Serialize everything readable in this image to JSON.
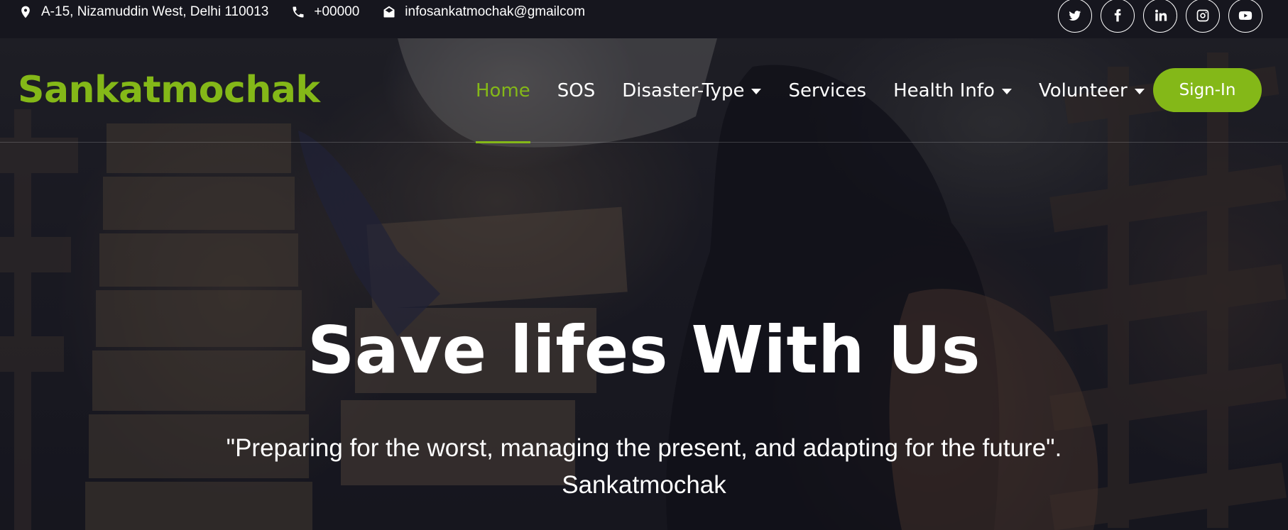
{
  "topbar": {
    "address": "A-15, Nizamuddin West, Delhi 110013",
    "phone": "+00000",
    "email": "infosankatmochak@gmailcom",
    "socials": [
      "twitter-icon",
      "facebook-icon",
      "linkedin-icon",
      "instagram-icon",
      "youtube-icon"
    ]
  },
  "navbar": {
    "brand": "Sankatmochak",
    "items": [
      {
        "label": "Home",
        "active": true,
        "dropdown": false
      },
      {
        "label": "SOS",
        "active": false,
        "dropdown": false
      },
      {
        "label": "Disaster-Type",
        "active": false,
        "dropdown": true
      },
      {
        "label": "Services",
        "active": false,
        "dropdown": false
      },
      {
        "label": "Health Info",
        "active": false,
        "dropdown": true
      },
      {
        "label": "Volunteer",
        "active": false,
        "dropdown": true
      }
    ],
    "signin_label": "Sign-In"
  },
  "hero": {
    "headline": "Save lifes With Us",
    "quote": "\"Preparing for the worst, managing the present, and adapting for the future\".",
    "attribution": "Sankatmochak"
  },
  "colors": {
    "accent": "#84b818",
    "topbar_bg": "#16161e"
  }
}
